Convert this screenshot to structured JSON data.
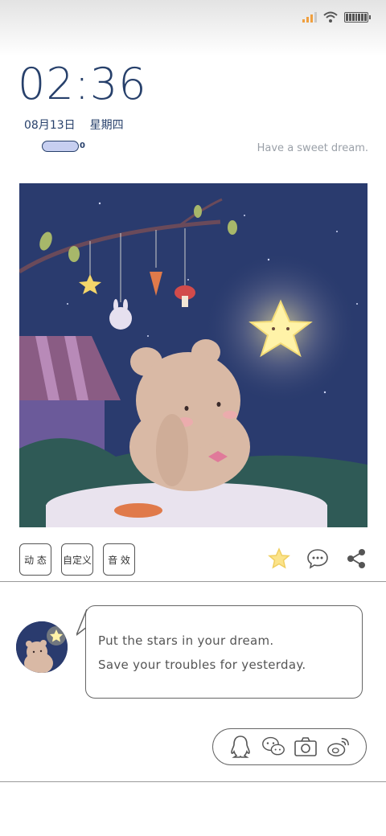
{
  "status_bar": {
    "signal_color": "#f0a040",
    "icons": [
      "signal-icon",
      "wifi-icon",
      "battery-icon"
    ]
  },
  "clock": {
    "time": "02:36",
    "date": "08月13日",
    "weekday": "星期四",
    "battery_text": "0"
  },
  "tagline": "Have a sweet dream.",
  "wallpaper": {
    "icon": "bear-star-night-illustration",
    "colors": {
      "sky": "#2a3b6e",
      "star": "#fff3a8",
      "bear": "#d9b9a5"
    }
  },
  "tags": [
    {
      "label": "动 态"
    },
    {
      "label": "自定义"
    },
    {
      "label": "音 效"
    }
  ],
  "actions": [
    "star-icon",
    "comment-icon",
    "share-icon"
  ],
  "message": {
    "line1": "Put the stars in your dream.",
    "line2": "Save your troubles for yesterday."
  },
  "share_targets": [
    "qq-icon",
    "wechat-icon",
    "camera-icon",
    "weibo-icon"
  ]
}
